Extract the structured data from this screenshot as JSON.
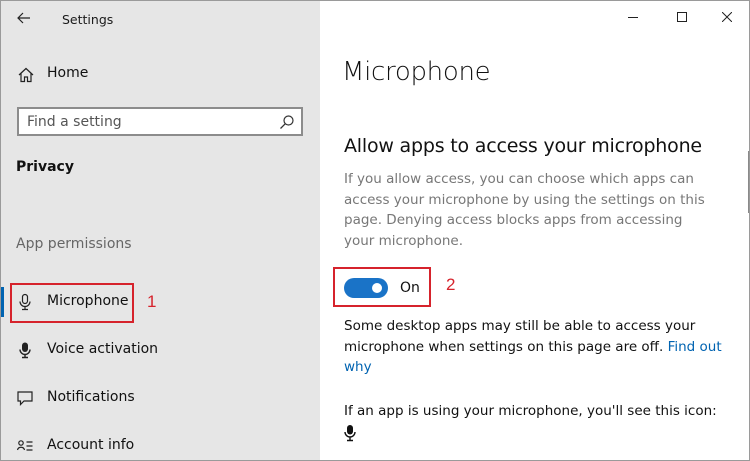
{
  "window": {
    "title": "Settings",
    "caption": {
      "minimize": "minimize-icon",
      "maximize": "maximize-icon",
      "close": "close-icon"
    }
  },
  "sidebar": {
    "home_label": "Home",
    "search_placeholder": "Find a setting",
    "section_title": "Privacy",
    "group_label": "App permissions",
    "items": [
      {
        "label": "Microphone",
        "icon": "microphone-icon",
        "selected": true
      },
      {
        "label": "Voice activation",
        "icon": "microphone-filled-icon",
        "selected": false
      },
      {
        "label": "Notifications",
        "icon": "speech-bubble-icon",
        "selected": false
      },
      {
        "label": "Account info",
        "icon": "contact-list-icon",
        "selected": false
      }
    ],
    "accent_color": "#0063b1"
  },
  "annotations": {
    "marker_1": "1",
    "marker_2": "2",
    "color": "#d6232c"
  },
  "main": {
    "page_title": "Microphone",
    "section_title": "Allow apps to access your microphone",
    "description": "If you allow access, you can choose which apps can access your microphone by using the settings on this page. Denying access blocks apps from accessing your microphone.",
    "toggle": {
      "state_label": "On",
      "on": true,
      "color": "#1a73c7"
    },
    "note_text": "Some desktop apps may still be able to access your microphone when settings on this page are off. ",
    "note_link": "Find out why",
    "icon_note_text": "If an app is using your microphone, you'll see this icon:"
  }
}
